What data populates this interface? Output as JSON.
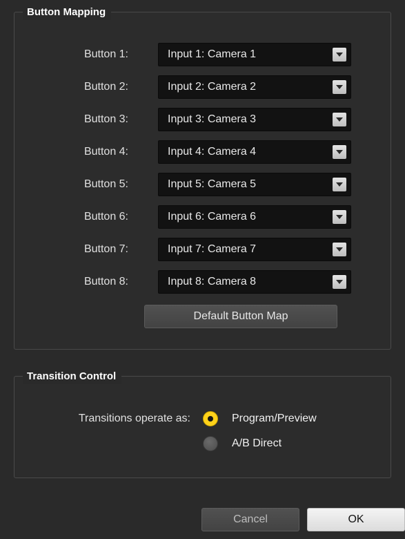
{
  "button_mapping": {
    "title": "Button Mapping",
    "rows": [
      {
        "label": "Button 1:",
        "value": "Input 1: Camera 1"
      },
      {
        "label": "Button 2:",
        "value": "Input 2: Camera 2"
      },
      {
        "label": "Button 3:",
        "value": "Input 3: Camera 3"
      },
      {
        "label": "Button 4:",
        "value": "Input 4: Camera 4"
      },
      {
        "label": "Button 5:",
        "value": "Input 5: Camera 5"
      },
      {
        "label": "Button 6:",
        "value": "Input 6: Camera 6"
      },
      {
        "label": "Button 7:",
        "value": "Input 7: Camera 7"
      },
      {
        "label": "Button 8:",
        "value": "Input 8: Camera 8"
      }
    ],
    "default_button_label": "Default Button Map"
  },
  "transition_control": {
    "title": "Transition Control",
    "label": "Transitions operate as:",
    "options": [
      {
        "label": "Program/Preview",
        "selected": true
      },
      {
        "label": "A/B Direct",
        "selected": false
      }
    ]
  },
  "footer": {
    "cancel_label": "Cancel",
    "ok_label": "OK"
  },
  "colors": {
    "accent": "#ffd21a",
    "background": "#2a2a2a"
  },
  "icons": {
    "dropdown": "chevron-down-icon"
  }
}
